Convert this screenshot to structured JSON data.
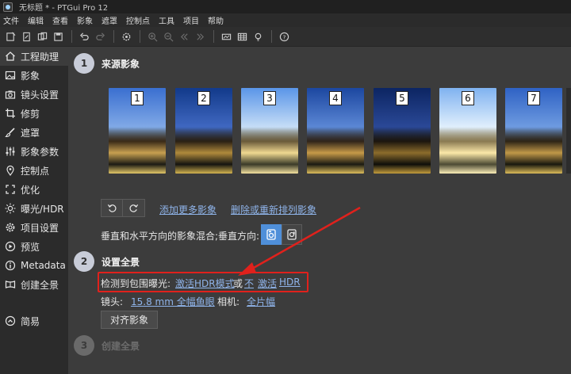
{
  "window": {
    "title": "无标题 * - PTGui Pro 12"
  },
  "menu": [
    "文件",
    "编辑",
    "查看",
    "影象",
    "遮罩",
    "控制点",
    "工具",
    "项目",
    "帮助"
  ],
  "toolbar": {
    "icons": [
      "new-project-icon",
      "open-project-icon",
      "open-folder-icon",
      "save-icon",
      "undo-icon",
      "redo-icon",
      "settings-icon",
      "zoom-in-icon",
      "zoom-out-icon",
      "prev-icon",
      "next-icon",
      "panorama-editor-icon",
      "table-icon",
      "bulb-icon",
      "help-icon"
    ]
  },
  "sidebar": {
    "items": [
      {
        "label": "工程助理",
        "icon": "home-icon",
        "active": true
      },
      {
        "label": "影象",
        "icon": "image-icon"
      },
      {
        "label": "镜头设置",
        "icon": "camera-icon"
      },
      {
        "label": "修剪",
        "icon": "crop-icon"
      },
      {
        "label": "遮罩",
        "icon": "brush-icon"
      },
      {
        "label": "影象参数",
        "icon": "sliders-icon"
      },
      {
        "label": "控制点",
        "icon": "pin-icon"
      },
      {
        "label": "优化",
        "icon": "optimize-icon"
      },
      {
        "label": "曝光/HDR",
        "icon": "sun-icon"
      },
      {
        "label": "项目设置",
        "icon": "gear-icon"
      },
      {
        "label": "预览",
        "icon": "eye-icon"
      },
      {
        "label": "Metadata",
        "icon": "info-icon"
      },
      {
        "label": "创建全景",
        "icon": "panorama-icon"
      }
    ],
    "simple": {
      "label": "简易",
      "icon": "circle-up-icon"
    }
  },
  "steps": {
    "step1": {
      "number": "1",
      "title": "来源影象"
    },
    "step2": {
      "number": "2",
      "title": "设置全景"
    },
    "step3": {
      "number": "3",
      "title": "创建全景"
    }
  },
  "thumbnails": [
    "1",
    "2",
    "3",
    "4",
    "5",
    "6",
    "7"
  ],
  "source": {
    "add_more": "添加更多影象",
    "remove_reorder": "删除或重新排列影象",
    "blend_label": "垂直和水平方向的影象混合;垂直方向:"
  },
  "panorama": {
    "bracket_detected": "检测到包围曝光:",
    "activate_hdr": "激活HDR模式",
    "or": "或",
    "not": "不",
    "activate": "激活",
    "hdr": "HDR",
    "lens_label": "镜头:",
    "lens_value": "15.8 mm 全幅鱼眼",
    "camera_label": "相机:",
    "camera_value": "全片幅",
    "align_button": "对齐影象"
  },
  "colors": {
    "accent": "#4f8fd9",
    "link": "#8fb4ea",
    "annotation": "#e0211c"
  }
}
